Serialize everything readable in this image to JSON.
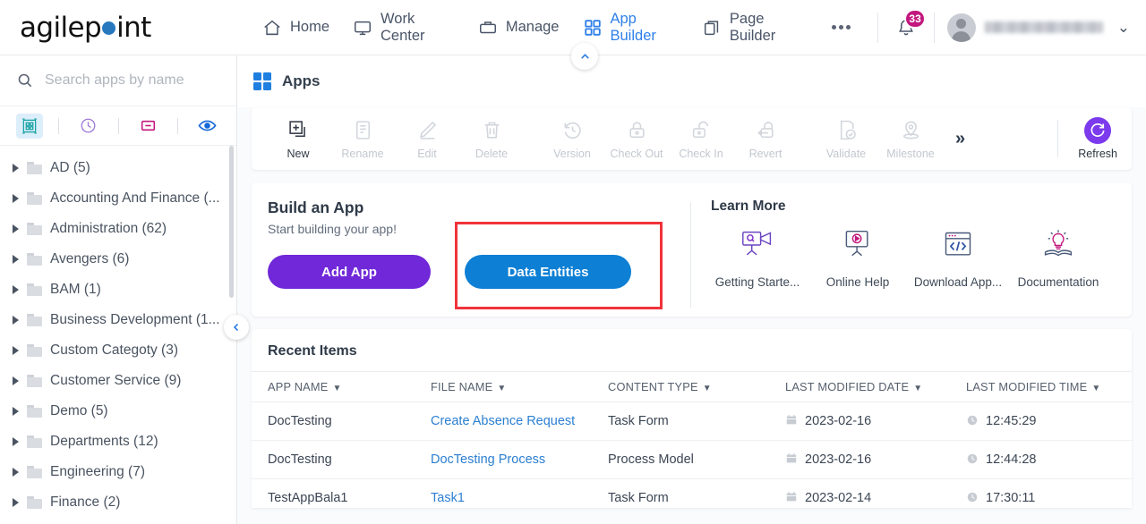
{
  "brand": {
    "name": "agilepoint",
    "dot_color": "#2878be"
  },
  "topnav": {
    "items": [
      {
        "label": "Home",
        "icon": "home-icon",
        "active": false
      },
      {
        "label": "Work Center",
        "icon": "monitor-icon",
        "active": false
      },
      {
        "label": "Manage",
        "icon": "briefcase-icon",
        "active": false
      },
      {
        "label": "App Builder",
        "icon": "grid-icon",
        "active": true
      },
      {
        "label": "Page Builder",
        "icon": "pages-icon",
        "active": false
      }
    ],
    "more_label": "•••",
    "notification_count": "33",
    "username": "",
    "accent_active": "#2f80e8",
    "badge_color": "#c2187e"
  },
  "sidebar": {
    "search": {
      "placeholder": "Search apps by name",
      "value": ""
    },
    "view_icons": [
      {
        "name": "apps-view-icon",
        "selected": true
      },
      {
        "name": "recent-clock-icon",
        "selected": false
      },
      {
        "name": "collapse-all-icon",
        "selected": false
      },
      {
        "name": "show-hidden-eye-icon",
        "selected": false
      }
    ],
    "tree": [
      {
        "label": "AD (5)"
      },
      {
        "label": "Accounting And Finance (..."
      },
      {
        "label": "Administration (62)"
      },
      {
        "label": "Avengers (6)"
      },
      {
        "label": "BAM (1)"
      },
      {
        "label": "Business Development (1..."
      },
      {
        "label": "Custom Categoty (3)"
      },
      {
        "label": "Customer Service (9)"
      },
      {
        "label": "Demo (5)"
      },
      {
        "label": "Departments (12)"
      },
      {
        "label": "Engineering (7)"
      },
      {
        "label": "Finance (2)"
      }
    ]
  },
  "main": {
    "page_title": "Apps",
    "toolbar": {
      "buttons": [
        {
          "label": "New",
          "icon": "new-app-icon",
          "enabled": true
        },
        {
          "label": "Rename",
          "icon": "rename-icon",
          "enabled": false
        },
        {
          "label": "Edit",
          "icon": "pencil-icon",
          "enabled": false
        },
        {
          "label": "Delete",
          "icon": "trash-icon",
          "enabled": false
        },
        {
          "label": "Version",
          "icon": "history-icon",
          "enabled": false
        },
        {
          "label": "Check Out",
          "icon": "lock-closed-icon",
          "enabled": false
        },
        {
          "label": "Check In",
          "icon": "lock-open-icon",
          "enabled": false
        },
        {
          "label": "Revert",
          "icon": "revert-lock-icon",
          "enabled": false
        },
        {
          "label": "Validate",
          "icon": "validate-check-icon",
          "enabled": false
        },
        {
          "label": "Milestone",
          "icon": "milestone-pin-icon",
          "enabled": false
        }
      ],
      "overflow_label": "»",
      "refresh_label": "Refresh",
      "refresh_color": "#7c3aed"
    },
    "build": {
      "heading": "Build an App",
      "subheading": "Start building your app!",
      "add_app_label": "Add App",
      "add_app_color": "#7028d8",
      "data_entities_label": "Data Entities",
      "data_entities_color": "#0d7fd4",
      "highlight_color": "#f0333a"
    },
    "learn": {
      "heading": "Learn More",
      "items": [
        {
          "label": "Getting Starte...",
          "icon": "video-camera-icon"
        },
        {
          "label": "Online Help",
          "icon": "play-screen-icon"
        },
        {
          "label": "Download App...",
          "icon": "code-window-icon"
        },
        {
          "label": "Documentation",
          "icon": "lightbulb-book-icon"
        }
      ]
    },
    "recent": {
      "heading": "Recent Items",
      "columns": [
        "APP NAME",
        "FILE NAME",
        "CONTENT TYPE",
        "LAST MODIFIED DATE",
        "LAST MODIFIED TIME"
      ],
      "rows": [
        {
          "app_name": "DocTesting",
          "file_name": "Create Absence Request",
          "content_type": "Task Form",
          "date": "2023-02-16",
          "time": "12:45:29"
        },
        {
          "app_name": "DocTesting",
          "file_name": "DocTesting Process",
          "content_type": "Process Model",
          "date": "2023-02-16",
          "time": "12:44:28"
        },
        {
          "app_name": "TestAppBala1",
          "file_name": "Task1",
          "content_type": "Task Form",
          "date": "2023-02-14",
          "time": "17:30:11"
        }
      ]
    }
  }
}
